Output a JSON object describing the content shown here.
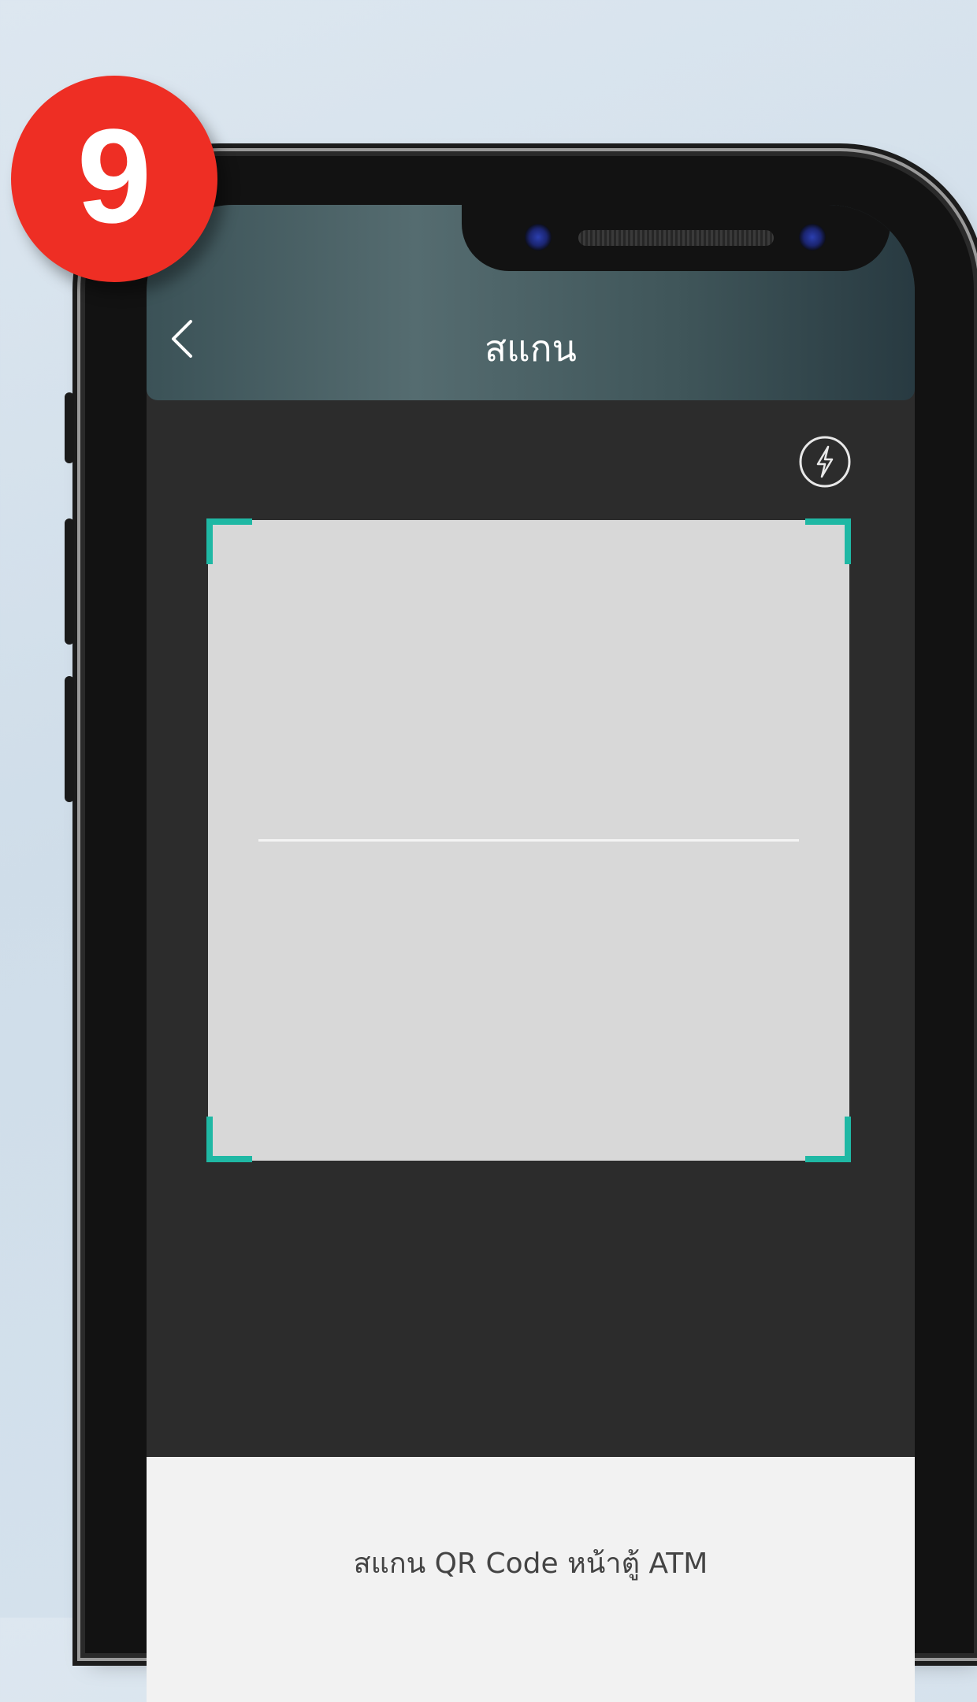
{
  "step": {
    "number": "9"
  },
  "header": {
    "title": "สแกน"
  },
  "scanner": {
    "flash_icon": "flash-icon",
    "back_icon": "chevron-left-icon",
    "frame_color": "#1fb8a4"
  },
  "bottom": {
    "instruction": "สแกน QR Code หน้าตู้ ATM"
  },
  "colors": {
    "badge": "#ee2e24",
    "screen_bg": "#2c2c2c",
    "scan_area": "#d8d8d8"
  }
}
